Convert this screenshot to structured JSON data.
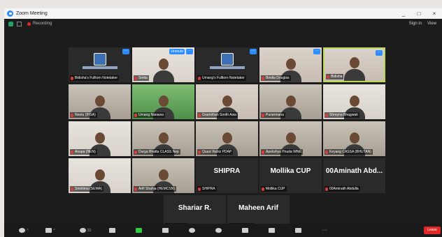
{
  "window": {
    "title": "Zoom Meeting",
    "minimize": "_",
    "maximize": "□",
    "close": "×"
  },
  "topbar": {
    "recording": "Recording",
    "sign_in": "Sign in",
    "view": "View"
  },
  "participants": [
    {
      "name": "Bidisha's Fulltorn Notetaker",
      "kind": "logo"
    },
    {
      "name": "Smita",
      "kind": "video",
      "badge": "Unmute"
    },
    {
      "name": "Umang's Fulltorn Notetaker",
      "kind": "logo"
    },
    {
      "name": "Bindia Douglas",
      "kind": "video"
    },
    {
      "name": "Bidisha",
      "kind": "video",
      "active": true
    },
    {
      "name": "Neetu (IHSA)",
      "kind": "video"
    },
    {
      "name": "Umang Nanawa",
      "kind": "video"
    },
    {
      "name": "Gramirhan Sooth Asia",
      "kind": "video"
    },
    {
      "name": "Puranmana",
      "kind": "video"
    },
    {
      "name": "Shreyna Bhagwati",
      "kind": "video"
    },
    {
      "name": "Anupa (NEN)",
      "kind": "video"
    },
    {
      "name": "Durga Bhatta CLASS Nep",
      "kind": "video"
    },
    {
      "name": "Quazi Rabiz PDAP",
      "kind": "video"
    },
    {
      "name": "Apekshya Pouda WNE",
      "kind": "video"
    },
    {
      "name": "Keyang CASSA (BHUTAN)",
      "kind": "video"
    },
    {
      "name": "Smritima (SEWA)",
      "kind": "video"
    },
    {
      "name": "Arifi Shahja (HEMCSN)",
      "kind": "video"
    },
    {
      "name": "SHIPRA",
      "kind": "text",
      "label": "SHIPRA"
    },
    {
      "name": "Mollika CUP",
      "kind": "text",
      "label": "Mollika CUP"
    },
    {
      "name": "00Aminath Abd...",
      "kind": "text",
      "label": "00Aminath Abdulla"
    },
    {
      "name": "Shariar R.",
      "kind": "text",
      "label": "Shariar R."
    },
    {
      "name": "Maheen Arif",
      "kind": "text",
      "label": "Maheen Arif"
    }
  ],
  "toolbar": {
    "participant_count": "22",
    "leave": "Leave"
  }
}
